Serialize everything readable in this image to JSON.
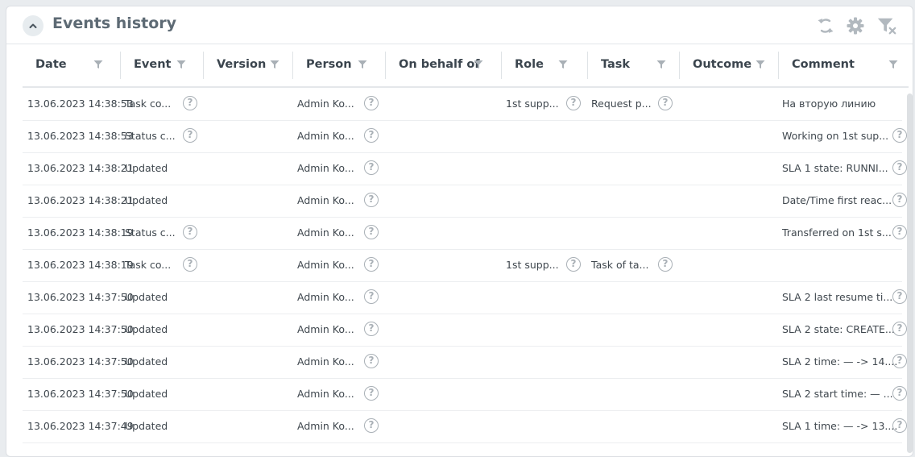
{
  "panel": {
    "title": "Events history"
  },
  "header_icons": [
    "refresh-icon",
    "settings-gear-icon",
    "clear-filter-icon"
  ],
  "columns": [
    {
      "key": "date",
      "label": "Date"
    },
    {
      "key": "event",
      "label": "Event"
    },
    {
      "key": "version",
      "label": "Version"
    },
    {
      "key": "person",
      "label": "Person"
    },
    {
      "key": "on_behalf_of",
      "label": "On behalf of"
    },
    {
      "key": "role",
      "label": "Role"
    },
    {
      "key": "task",
      "label": "Task"
    },
    {
      "key": "outcome",
      "label": "Outcome"
    },
    {
      "key": "comment",
      "label": "Comment"
    }
  ],
  "rows": [
    {
      "date": "13.06.2023 14:38:53",
      "event": "Task co...",
      "event_info": true,
      "person": "Admin Ko...",
      "person_info": true,
      "role": "1st supp...",
      "role_info": true,
      "task": "Request p...",
      "task_info": true,
      "comment": "На вторую линию",
      "comment_info": false
    },
    {
      "date": "13.06.2023 14:38:53",
      "event": "Status c...",
      "event_info": true,
      "person": "Admin Ko...",
      "person_info": true,
      "role": "",
      "role_info": false,
      "task": "",
      "task_info": false,
      "comment": "Working on 1st sup...",
      "comment_info": true
    },
    {
      "date": "13.06.2023 14:38:21",
      "event": "Updated",
      "event_info": false,
      "person": "Admin Ko...",
      "person_info": true,
      "role": "",
      "role_info": false,
      "task": "",
      "task_info": false,
      "comment": "SLA 1 state: RUNNI...",
      "comment_info": true
    },
    {
      "date": "13.06.2023 14:38:21",
      "event": "Updated",
      "event_info": false,
      "person": "Admin Ko...",
      "person_info": true,
      "role": "",
      "role_info": false,
      "task": "",
      "task_info": false,
      "comment": "Date/Time first reac...",
      "comment_info": true
    },
    {
      "date": "13.06.2023 14:38:19",
      "event": "Status c...",
      "event_info": true,
      "person": "Admin Ko...",
      "person_info": true,
      "role": "",
      "role_info": false,
      "task": "",
      "task_info": false,
      "comment": "Transferred on 1st s...",
      "comment_info": true
    },
    {
      "date": "13.06.2023 14:38:19",
      "event": "Task co...",
      "event_info": true,
      "person": "Admin Ko...",
      "person_info": true,
      "role": "1st supp...",
      "role_info": true,
      "task": "Task of ta...",
      "task_info": true,
      "comment": "",
      "comment_info": false
    },
    {
      "date": "13.06.2023 14:37:50",
      "event": "Updated",
      "event_info": false,
      "person": "Admin Ko...",
      "person_info": true,
      "role": "",
      "role_info": false,
      "task": "",
      "task_info": false,
      "comment": "SLA 2 last resume ti...",
      "comment_info": true
    },
    {
      "date": "13.06.2023 14:37:50",
      "event": "Updated",
      "event_info": false,
      "person": "Admin Ko...",
      "person_info": true,
      "role": "",
      "role_info": false,
      "task": "",
      "task_info": false,
      "comment": "SLA 2 state: CREATE...",
      "comment_info": true
    },
    {
      "date": "13.06.2023 14:37:50",
      "event": "Updated",
      "event_info": false,
      "person": "Admin Ko...",
      "person_info": true,
      "role": "",
      "role_info": false,
      "task": "",
      "task_info": false,
      "comment": "SLA 2 time: — -> 14....",
      "comment_info": true
    },
    {
      "date": "13.06.2023 14:37:50",
      "event": "Updated",
      "event_info": false,
      "person": "Admin Ko...",
      "person_info": true,
      "role": "",
      "role_info": false,
      "task": "",
      "task_info": false,
      "comment": "SLA 2 start time: — ...",
      "comment_info": true
    },
    {
      "date": "13.06.2023 14:37:49",
      "event": "Updated",
      "event_info": false,
      "person": "Admin Ko...",
      "person_info": true,
      "role": "",
      "role_info": false,
      "task": "",
      "task_info": false,
      "comment": "SLA 1 time: — -> 13....",
      "comment_info": true
    }
  ],
  "info_glyph": "?",
  "colors": {
    "accent_icon": "#b2b9bf",
    "text": "#3f474e",
    "header_text": "#3b454e",
    "title": "#5d6a74"
  }
}
